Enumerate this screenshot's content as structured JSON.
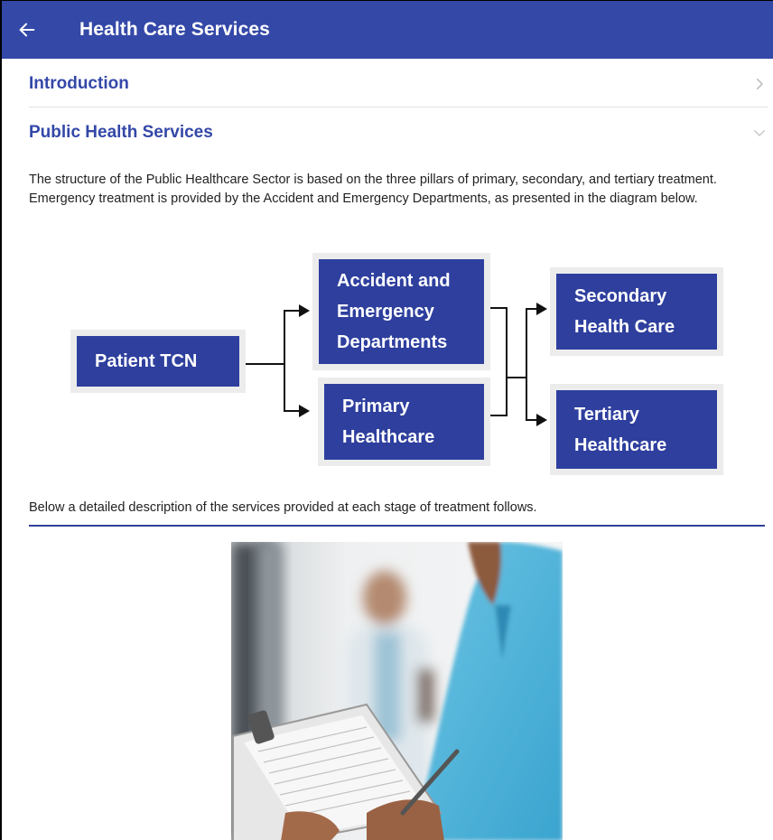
{
  "appbar": {
    "title": "Health Care Services",
    "back_icon": "arrow-left-icon",
    "background": "#3448a8"
  },
  "sections": [
    {
      "label": "Introduction",
      "icon": "chevron-right-icon",
      "expanded": false
    },
    {
      "label": "Public Health Services",
      "icon": "chevron-down-icon",
      "expanded": true
    }
  ],
  "content": {
    "paragraph": "The structure of the Public Healthcare Sector is based on the three pillars of primary, secondary, and tertiary treatment. Emergency treatment is provided by the Accident and Emergency Departments, as presented in the diagram below.",
    "below_text": "Below a detailed description of the services provided at each stage of treatment follows."
  },
  "diagram": {
    "nodes": {
      "patient": "Patient TCN",
      "accident": [
        "Accident and",
        "Emergency",
        "Departments"
      ],
      "primary": [
        "Primary",
        "Healthcare"
      ],
      "secondary": [
        "Secondary",
        "Health Care"
      ],
      "tertiary": [
        "Tertiary",
        "Healthcare"
      ]
    },
    "box_color": "#2e3f9e"
  },
  "image": {
    "subject": "nurse-with-clipboard-photo"
  }
}
